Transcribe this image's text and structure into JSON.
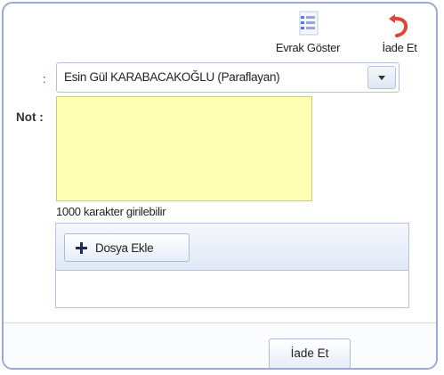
{
  "toolbar": {
    "show_document_label": "Evrak Göster",
    "show_document_icon": "document-list-icon",
    "return_label": "İade Et",
    "return_icon": "undo-arrow-icon",
    "return_icon_color": "#e0443a"
  },
  "form": {
    "recipient_prefix": ":",
    "recipient_value": "Esin Gül KARABACAKOĞLU (Paraflayan)",
    "note_label": "Not :",
    "note_value": "",
    "note_color": "#ffffb4",
    "char_hint": "1000 karakter girilebilir"
  },
  "upload": {
    "add_file_label": "Dosya Ekle",
    "add_icon": "plus-icon"
  },
  "footer": {
    "submit_label": "İade Et"
  }
}
